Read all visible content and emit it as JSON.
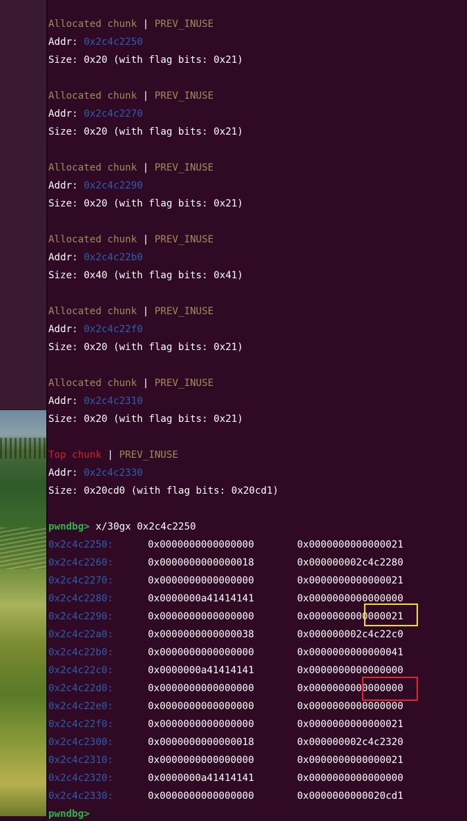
{
  "chunks": [
    {
      "kind": "Allocated chunk",
      "flag": "PREV_INUSE",
      "addr_label": "Addr: ",
      "addr": "0x2c4c2250",
      "size": "Size: 0x20 (with flag bits: 0x21)"
    },
    {
      "kind": "Allocated chunk",
      "flag": "PREV_INUSE",
      "addr_label": "Addr: ",
      "addr": "0x2c4c2270",
      "size": "Size: 0x20 (with flag bits: 0x21)"
    },
    {
      "kind": "Allocated chunk",
      "flag": "PREV_INUSE",
      "addr_label": "Addr: ",
      "addr": "0x2c4c2290",
      "size": "Size: 0x20 (with flag bits: 0x21)"
    },
    {
      "kind": "Allocated chunk",
      "flag": "PREV_INUSE",
      "addr_label": "Addr: ",
      "addr": "0x2c4c22b0",
      "size": "Size: 0x40 (with flag bits: 0x41)"
    },
    {
      "kind": "Allocated chunk",
      "flag": "PREV_INUSE",
      "addr_label": "Addr: ",
      "addr": "0x2c4c22f0",
      "size": "Size: 0x20 (with flag bits: 0x21)"
    },
    {
      "kind": "Allocated chunk",
      "flag": "PREV_INUSE",
      "addr_label": "Addr: ",
      "addr": "0x2c4c2310",
      "size": "Size: 0x20 (with flag bits: 0x21)"
    }
  ],
  "top_chunk": {
    "kind": "Top chunk",
    "flag": "PREV_INUSE",
    "addr_label": "Addr: ",
    "addr": "0x2c4c2330",
    "size": "Size: 0x20cd0 (with flag bits: 0x20cd1)"
  },
  "separator": " | ",
  "prompt": {
    "name": "pwndbg>",
    "command": " x/30gx 0x2c4c2250"
  },
  "memory": [
    {
      "addr": "0x2c4c2250:",
      "v1": "0x0000000000000000",
      "v2": "0x0000000000000021"
    },
    {
      "addr": "0x2c4c2260:",
      "v1": "0x0000000000000018",
      "v2": "0x000000002c4c2280"
    },
    {
      "addr": "0x2c4c2270:",
      "v1": "0x0000000000000000",
      "v2": "0x0000000000000021"
    },
    {
      "addr": "0x2c4c2280:",
      "v1": "0x0000000a41414141",
      "v2": "0x0000000000000000"
    },
    {
      "addr": "0x2c4c2290:",
      "v1": "0x0000000000000000",
      "v2": "0x0000000000000021"
    },
    {
      "addr": "0x2c4c22a0:",
      "v1": "0x0000000000000038",
      "v2": "0x000000002c4c22c0"
    },
    {
      "addr": "0x2c4c22b0:",
      "v1": "0x0000000000000000",
      "v2": "0x0000000000000041"
    },
    {
      "addr": "0x2c4c22c0:",
      "v1": "0x0000000a41414141",
      "v2": "0x0000000000000000"
    },
    {
      "addr": "0x2c4c22d0:",
      "v1": "0x0000000000000000",
      "v2": "0x0000000000000000"
    },
    {
      "addr": "0x2c4c22e0:",
      "v1": "0x0000000000000000",
      "v2": "0x0000000000000000"
    },
    {
      "addr": "0x2c4c22f0:",
      "v1": "0x0000000000000000",
      "v2": "0x0000000000000021"
    },
    {
      "addr": "0x2c4c2300:",
      "v1": "0x0000000000000018",
      "v2": "0x000000002c4c2320"
    },
    {
      "addr": "0x2c4c2310:",
      "v1": "0x0000000000000000",
      "v2": "0x0000000000000021"
    },
    {
      "addr": "0x2c4c2320:",
      "v1": "0x0000000a41414141",
      "v2": "0x0000000000000000"
    },
    {
      "addr": "0x2c4c2330:",
      "v1": "0x0000000000000000",
      "v2": "0x0000000000020cd1"
    }
  ],
  "next_prompt": "pwndbg>",
  "colors": {
    "background": "#300a24",
    "chunk_label": "#a48a5a",
    "address": "#2a5fb0",
    "top_chunk": "#d0202a",
    "prompt": "#2fb34a",
    "highlight_yellow": "#f2e21e",
    "highlight_red": "#e0262a"
  }
}
